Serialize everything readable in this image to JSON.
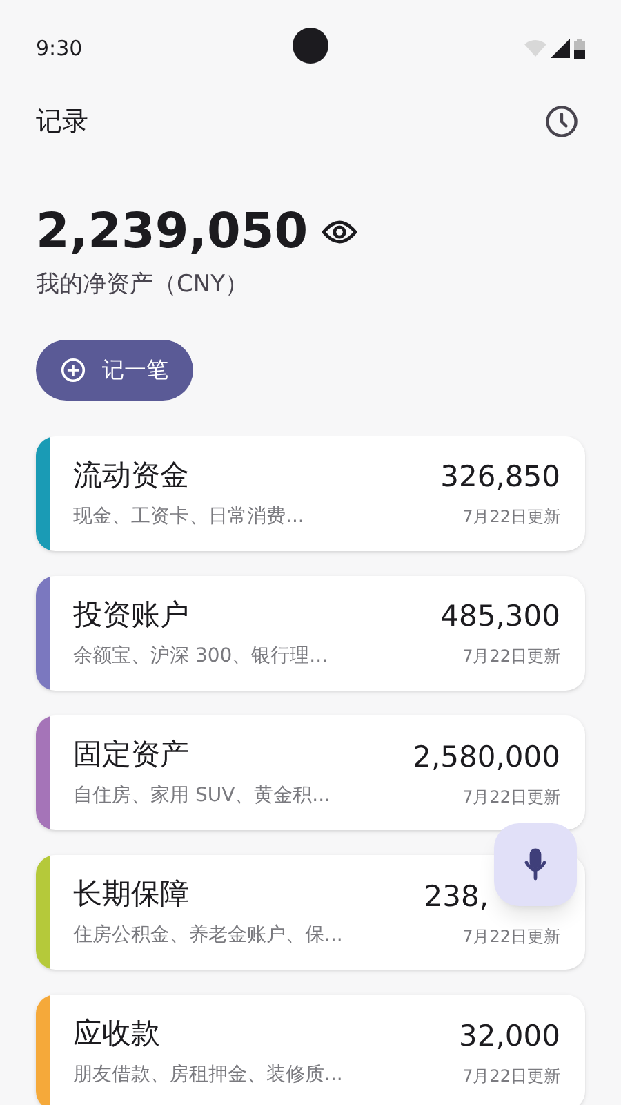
{
  "status_bar": {
    "time": "9:30"
  },
  "header": {
    "title": "记录"
  },
  "net_worth": {
    "amount": "2,239,050",
    "label": "我的净资产（CNY）"
  },
  "add_button": {
    "label": "记一笔"
  },
  "accounts": [
    {
      "name": "流动资金",
      "detail": "现金、工资卡、日常消费...",
      "amount": "326,850",
      "updated": "7月22日更新",
      "color": "#1a9bb5"
    },
    {
      "name": "投资账户",
      "detail": "余额宝、沪深 300、银行理...",
      "amount": "485,300",
      "updated": "7月22日更新",
      "color": "#7b78bf"
    },
    {
      "name": "固定资产",
      "detail": "自住房、家用 SUV、黄金积...",
      "amount": "2,580,000",
      "updated": "7月22日更新",
      "color": "#a574b8"
    },
    {
      "name": "长期保障",
      "detail": "住房公积金、养老金账户、保...",
      "amount": "238,",
      "amount_covered": true,
      "updated": "7月22日更新",
      "color": "#b5c93a"
    },
    {
      "name": "应收款",
      "detail": "朋友借款、房租押金、装修质...",
      "amount": "32,000",
      "updated": "7月22日更新",
      "color": "#f5a93a"
    }
  ]
}
